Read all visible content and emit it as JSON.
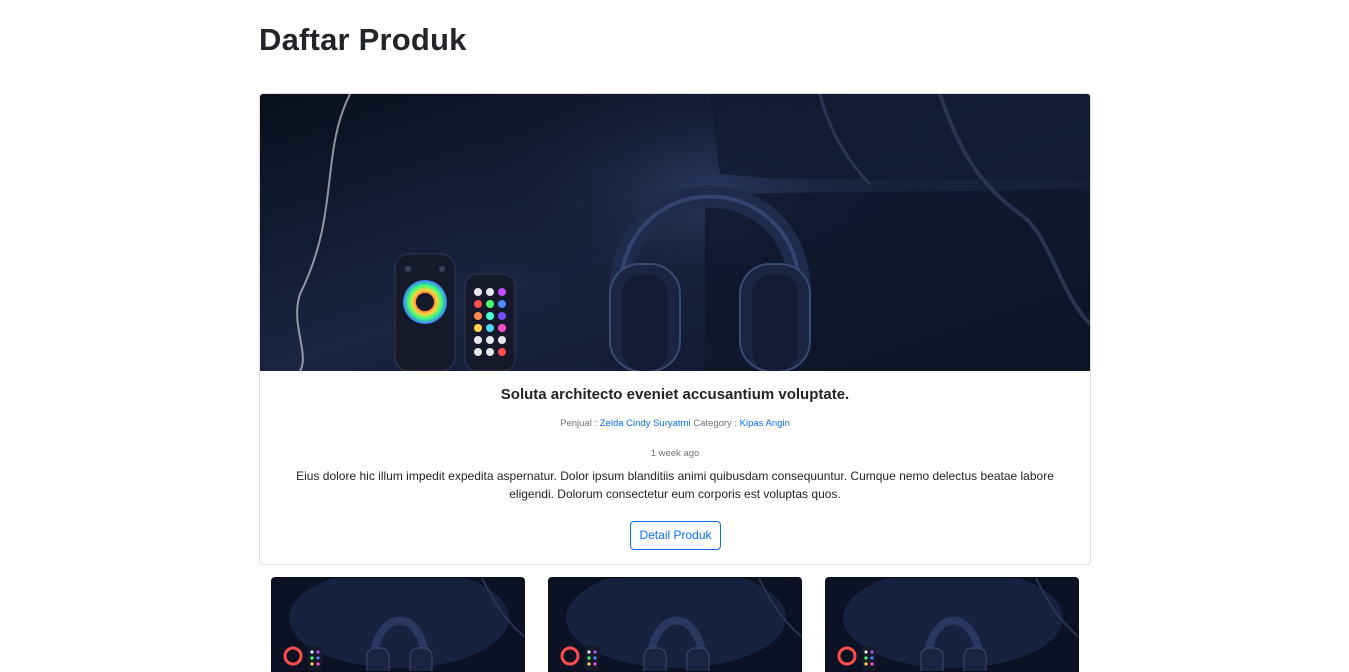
{
  "page": {
    "title": "Daftar Produk"
  },
  "featured": {
    "image_alt": "Headphones on a dark desk with LED remotes",
    "title": "Soluta architecto eveniet accusantium voluptate.",
    "seller_label": "Penjual :",
    "seller_name": "Zelda Cindy Suryatmi",
    "category_label": "Category :",
    "category_name": "Kipas Angin",
    "time_ago": "1 week ago",
    "description": "Eius dolore hic illum impedit expedita aspernatur. Dolor ipsum blanditiis animi quibusdam consequuntur. Cumque nemo delectus beatae labore eligendi. Dolorum consectetur eum corporis est voluptas quos.",
    "button_label": "Detail Produk"
  },
  "grid_cards": [
    {
      "image_alt": "Headphones product image"
    },
    {
      "image_alt": "Headphones product image"
    },
    {
      "image_alt": "Headphones product image"
    }
  ],
  "colors": {
    "link": "#0d6efd",
    "muted": "#6c757d",
    "text": "#212529",
    "image_bg": "#0c1224"
  }
}
